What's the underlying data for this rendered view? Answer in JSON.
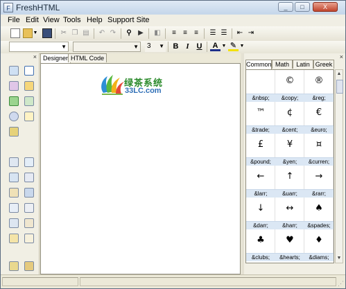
{
  "window": {
    "title": "FreshHTML"
  },
  "menu": [
    "File",
    "Edit",
    "View",
    "Tools",
    "Help",
    "Support Site"
  ],
  "toolbar2": {
    "font_size": "3"
  },
  "editor": {
    "tabs": [
      "Designer",
      "HTML Code"
    ],
    "logo_cn": "绿茶系统",
    "logo_en": "33LC.com"
  },
  "char_panel": {
    "tabs": [
      "Common",
      "Math",
      "Latin",
      "Greek"
    ],
    "rows": [
      [
        {
          "sym": "",
          "ent": "&nbsp;"
        },
        {
          "sym": "©",
          "ent": "&copy;"
        },
        {
          "sym": "®",
          "ent": "&reg;"
        }
      ],
      [
        {
          "sym": "™",
          "ent": "&trade;"
        },
        {
          "sym": "¢",
          "ent": "&cent;"
        },
        {
          "sym": "€",
          "ent": "&euro;"
        }
      ],
      [
        {
          "sym": "£",
          "ent": "&pound;"
        },
        {
          "sym": "¥",
          "ent": "&yen;"
        },
        {
          "sym": "¤",
          "ent": "&curren;"
        }
      ],
      [
        {
          "sym": "←",
          "ent": "&larr;"
        },
        {
          "sym": "↑",
          "ent": "&uarr;"
        },
        {
          "sym": "→",
          "ent": "&rarr;"
        }
      ],
      [
        {
          "sym": "↓",
          "ent": "&darr;"
        },
        {
          "sym": "↔",
          "ent": "&harr;"
        },
        {
          "sym": "♠",
          "ent": "&spades;"
        }
      ],
      [
        {
          "sym": "♣",
          "ent": "&clubs;"
        },
        {
          "sym": "♥",
          "ent": "&hearts;"
        },
        {
          "sym": "♦",
          "ent": "&diams;"
        }
      ]
    ]
  }
}
